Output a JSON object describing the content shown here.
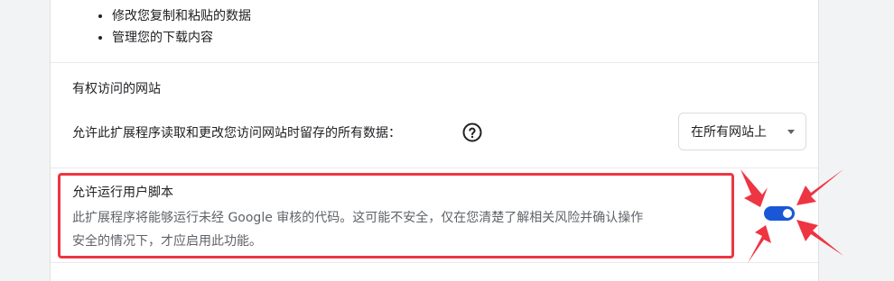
{
  "permissions": {
    "items": [
      "修改您复制和粘贴的数据",
      "管理您的下载内容"
    ]
  },
  "site_access": {
    "title": "有权访问的网站",
    "description": "允许此扩展程序读取和更改您访问网站时留存的所有数据：",
    "help_icon": "question-circle-icon",
    "select": {
      "value": "在所有网站上"
    }
  },
  "user_scripts": {
    "title": "允许运行用户脚本",
    "description_line1": "此扩展程序将能够运行未经 Google 审核的代码。这可能不安全，仅在您清楚了解相关风险并确认操作",
    "description_line2": "安全的情况下，才应启用此功能。",
    "toggle_on": true
  },
  "colors": {
    "annotation_red": "#ee3542",
    "toggle_blue": "#1a57d6"
  }
}
